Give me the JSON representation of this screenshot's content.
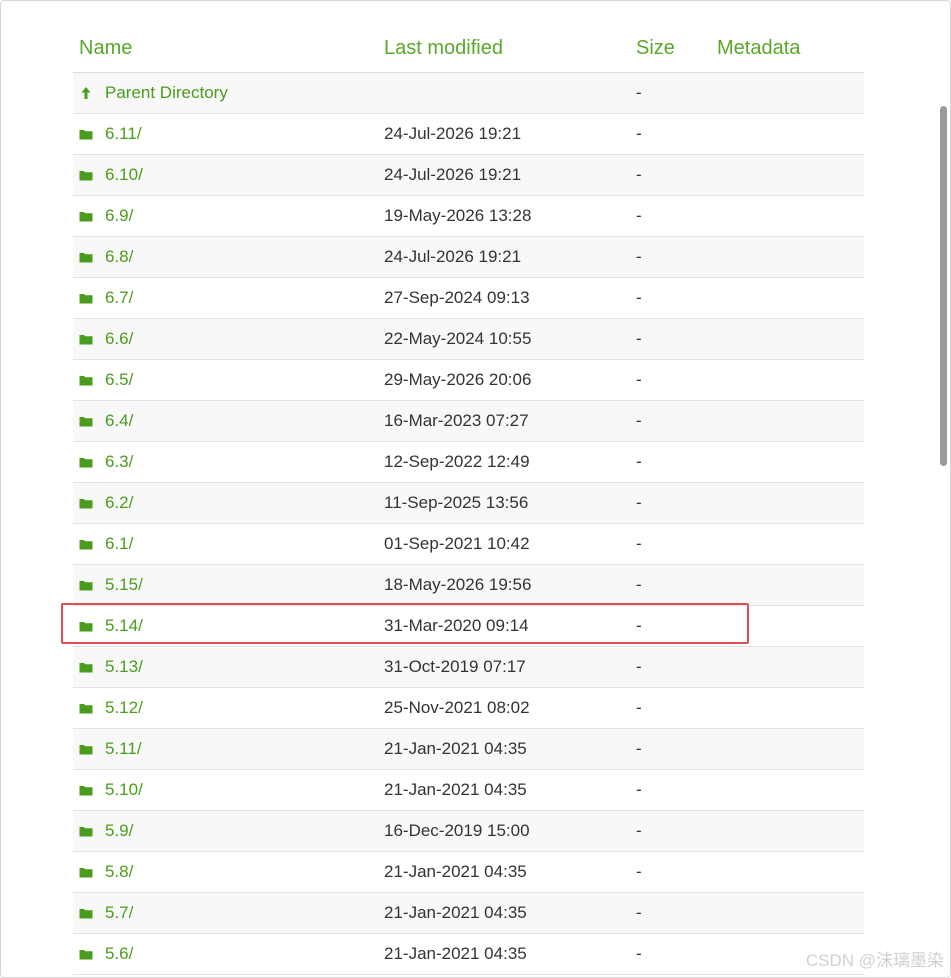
{
  "columns": {
    "name": "Name",
    "last_modified": "Last modified",
    "size": "Size",
    "metadata": "Metadata"
  },
  "parent": {
    "label": "Parent Directory",
    "size": "-",
    "icon": "arrow-up-icon"
  },
  "rows": [
    {
      "name": "6.11/",
      "date": "24-Jul-2026 19:21",
      "size": "-"
    },
    {
      "name": "6.10/",
      "date": "24-Jul-2026 19:21",
      "size": "-"
    },
    {
      "name": "6.9/",
      "date": "19-May-2026 13:28",
      "size": "-"
    },
    {
      "name": "6.8/",
      "date": "24-Jul-2026 19:21",
      "size": "-"
    },
    {
      "name": "6.7/",
      "date": "27-Sep-2024 09:13",
      "size": "-"
    },
    {
      "name": "6.6/",
      "date": "22-May-2024 10:55",
      "size": "-"
    },
    {
      "name": "6.5/",
      "date": "29-May-2026 20:06",
      "size": "-"
    },
    {
      "name": "6.4/",
      "date": "16-Mar-2023 07:27",
      "size": "-"
    },
    {
      "name": "6.3/",
      "date": "12-Sep-2022 12:49",
      "size": "-"
    },
    {
      "name": "6.2/",
      "date": "11-Sep-2025 13:56",
      "size": "-"
    },
    {
      "name": "6.1/",
      "date": "01-Sep-2021 10:42",
      "size": "-"
    },
    {
      "name": "5.15/",
      "date": "18-May-2026 19:56",
      "size": "-"
    },
    {
      "name": "5.14/",
      "date": "31-Mar-2020 09:14",
      "size": "-"
    },
    {
      "name": "5.13/",
      "date": "31-Oct-2019 07:17",
      "size": "-"
    },
    {
      "name": "5.12/",
      "date": "25-Nov-2021 08:02",
      "size": "-"
    },
    {
      "name": "5.11/",
      "date": "21-Jan-2021 04:35",
      "size": "-"
    },
    {
      "name": "5.10/",
      "date": "21-Jan-2021 04:35",
      "size": "-"
    },
    {
      "name": "5.9/",
      "date": "16-Dec-2019 15:00",
      "size": "-"
    },
    {
      "name": "5.8/",
      "date": "21-Jan-2021 04:35",
      "size": "-"
    },
    {
      "name": "5.7/",
      "date": "21-Jan-2021 04:35",
      "size": "-"
    },
    {
      "name": "5.6/",
      "date": "21-Jan-2021 04:35",
      "size": "-"
    }
  ],
  "highlighted_row": "5.14/",
  "watermark": "CSDN @沫璃墨染",
  "colors": {
    "link_green": "#4a9d1c",
    "header_green": "#5aa829",
    "highlight_red": "#e04d55"
  }
}
